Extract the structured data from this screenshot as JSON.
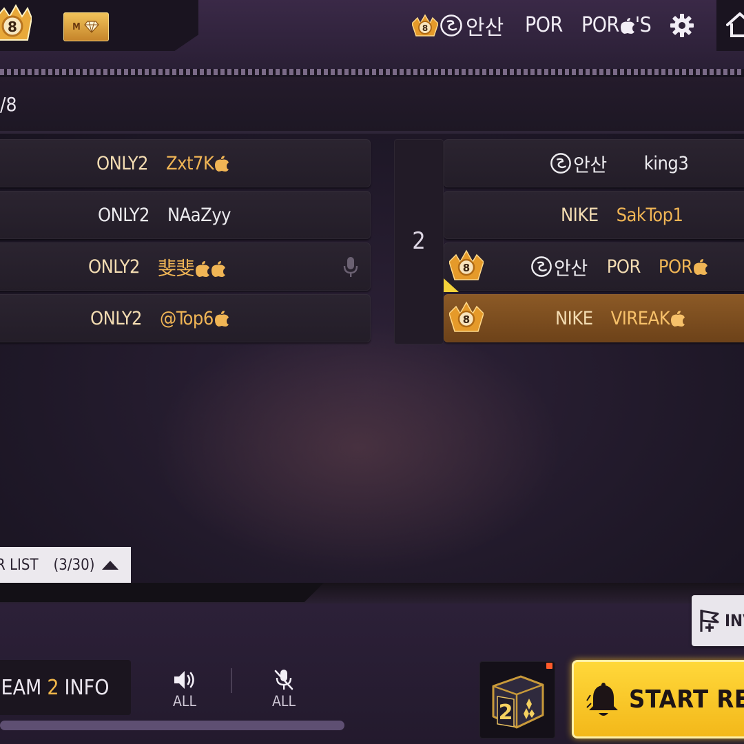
{
  "top_bar": {
    "rank_badge_level": "8",
    "m_badge_label": "M",
    "player_clan": "안산",
    "player_tag": "POR",
    "player_name": "POR",
    "player_name_suffix": "'S"
  },
  "room": {
    "header_text": "/8"
  },
  "team1": {
    "rows": [
      {
        "clan": "ONLY2",
        "name": "Zxt7K",
        "apples": 1,
        "name_color": "gold"
      },
      {
        "clan": "ONLY2",
        "name": "NAaZyy",
        "apples": 0,
        "name_color": "white"
      },
      {
        "clan": "ONLY2",
        "name": "斐斐",
        "apples": 2,
        "name_color": "gold",
        "mic": true
      },
      {
        "clan": "ONLY2",
        "name": "@Top6",
        "apples": 1,
        "name_color": "gold"
      }
    ]
  },
  "team2": {
    "number": "2",
    "rows": [
      {
        "clan_logo": true,
        "clan": "안산",
        "name": "king3",
        "apples": 0,
        "name_color": "white"
      },
      {
        "clan": "NIKE",
        "name": "SakTop1",
        "apples": 0,
        "name_color": "gold"
      },
      {
        "clan_logo": true,
        "clan": "안산",
        "tag": "POR",
        "name": "POR",
        "apples": 1,
        "name_color": "gold",
        "rank_icon": true,
        "marker": true
      },
      {
        "clan": "NIKE",
        "name": "VIREAK",
        "apples": 1,
        "name_color": "gold",
        "rank_icon": true,
        "highlight": true
      }
    ]
  },
  "player_list": {
    "label": "R LIST",
    "count": "(3/30)"
  },
  "bottom": {
    "invite_label": "INV",
    "team_info_prefix": "EAM",
    "team_info_number": "2",
    "team_info_suffix": "INFO",
    "speaker_label": "ALL",
    "mic_label": "ALL",
    "box_number": "2",
    "start_label": "START REI"
  },
  "colors": {
    "gold_text": "#f0b555",
    "accent_yellow": "#f3b84a",
    "start_button": "#ffd83a",
    "highlight_row": "#8c5a26"
  },
  "icons": [
    "rank-badge-icon",
    "m-diamond-icon",
    "clan-ring-logo-icon",
    "apple-icon",
    "gear-icon",
    "home-icon",
    "mic-icon",
    "speaker-icon",
    "mic-muted-icon",
    "flag-plus-icon",
    "bell-icon",
    "dice-box-icon",
    "chevron-up-icon"
  ]
}
